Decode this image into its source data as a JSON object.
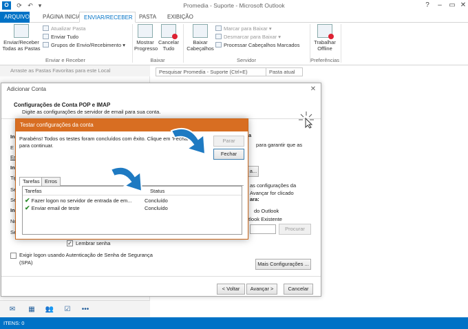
{
  "window": {
    "title": "Promedia - Suporte - Microsoft Outlook",
    "app_icon": "O"
  },
  "tabs": [
    "ARQUIVO",
    "PÁGINA INICIAL",
    "ENVIAR/RECEBER",
    "PASTA",
    "EXIBIÇÃO"
  ],
  "ribbon": {
    "send_receive_all": "Enviar/Receber Todas as Pastas",
    "update_folder": "Atualizar Pasta",
    "send_all": "Enviar Tudo",
    "groups": "Grupos de Envio/Recebimento",
    "group_send_receive": "Enviar e Receber",
    "show_progress": "Mostrar Progresso",
    "cancel_all": "Cancelar Tudo",
    "group_download": "Baixar",
    "download_headers": "Baixar Cabeçalhos",
    "mark_download": "Marcar para Baixar",
    "unmark_download": "Desmarcar para Baixar",
    "process_headers": "Processar Cabeçalhos Marcados",
    "group_server": "Servidor",
    "work_offline": "Trabalhar Offline",
    "group_prefs": "Preferências"
  },
  "favorites_hint": "Arraste as Pastas Favoritas para este Local",
  "search": {
    "placeholder": "Pesquisar Promedia - Suporte (Ctrl+E)",
    "scope": "Pasta atual"
  },
  "status": "ITENS: 0",
  "dialog": {
    "title": "Adicionar Conta",
    "heading": "Configurações de Conta POP e IMAP",
    "subheading": "Digite as configurações de servidor de email para sua conta.",
    "right_text_1": "a",
    "right_text_2": "para garantir que as",
    "right_btn": "a...",
    "right_text_3": "as configurações da",
    "right_text_4": "Avançar for clicado",
    "right_text_5": "ara:",
    "right_text_6": "do Outlook",
    "right_text_7": "utlook Existente",
    "browse": "Procurar",
    "remember": "Lembrar senha",
    "spa": "Exigir logon usando Autenticação de Senha de Segurança (SPA)",
    "more_settings": "Mais Configurações ...",
    "back": "< Voltar",
    "next": "Avançar >",
    "cancel": "Cancelar",
    "left_frag": [
      "In",
      "E",
      "En",
      "In",
      "Tip",
      "Se",
      "Se",
      "In",
      "No",
      "Se"
    ]
  },
  "test": {
    "title": "Testar configurações da conta",
    "message": "Parabéns! Todos os testes foram concluídos com êxito. Clique em 'Fechar' para continuar.",
    "stop": "Parar",
    "close": "Fechar",
    "tabs": [
      "Tarefas",
      "Erros"
    ],
    "col_tasks": "Tarefas",
    "col_status": "Status",
    "rows": [
      {
        "task": "Fazer logon no servidor de entrada de em...",
        "status": "Concluído"
      },
      {
        "task": "Enviar email de teste",
        "status": "Concluído"
      }
    ]
  }
}
